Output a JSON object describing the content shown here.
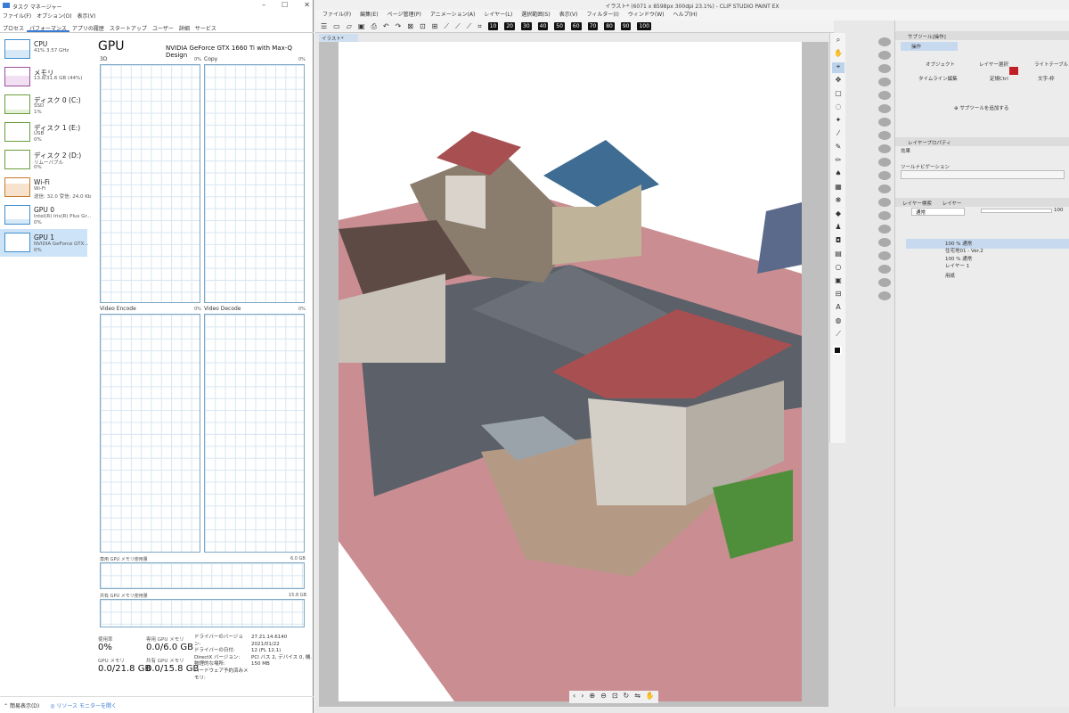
{
  "task_manager": {
    "title": "タスク マネージャー",
    "menu": [
      "ファイル(F)",
      "オプション(O)",
      "表示(V)"
    ],
    "tabs": [
      "プロセス",
      "パフォーマンス",
      "アプリの履歴",
      "スタートアップ",
      "ユーザー",
      "詳細",
      "サービス"
    ],
    "sidebar": [
      {
        "name": "CPU",
        "line1": "41% 3.57 GHz",
        "line2": ""
      },
      {
        "name": "メモリ",
        "line1": "13.8/31.6 GB (44%)",
        "line2": ""
      },
      {
        "name": "ディスク 0 (C:)",
        "line1": "SSD",
        "line2": "1%"
      },
      {
        "name": "ディスク 1 (E:)",
        "line1": "USB",
        "line2": "0%"
      },
      {
        "name": "ディスク 2 (D:)",
        "line1": "リムーバブル",
        "line2": "0%"
      },
      {
        "name": "Wi-Fi",
        "line1": "Wi-Fi",
        "line2": "送信: 32.0 受信: 24.0 Kb"
      },
      {
        "name": "GPU 0",
        "line1": "Intel(R) Iris(R) Plus Gr...",
        "line2": "0%"
      },
      {
        "name": "GPU 1",
        "line1": "NVIDIA GeForce GTX...",
        "line2": "0%"
      }
    ],
    "gpu_title": "GPU",
    "gpu_name": "NVIDIA GeForce GTX 1660 Ti with Max-Q Design",
    "graphs": [
      {
        "label": "3D",
        "pct": "0%"
      },
      {
        "label": "Copy",
        "pct": "0%"
      },
      {
        "label": "Video Encode",
        "pct": "0%"
      },
      {
        "label": "Video Decode",
        "pct": "0%"
      }
    ],
    "dedicated_label": "専用 GPU メモリ使用量",
    "dedicated_max": "6.0 GB",
    "shared_label": "共有 GPU メモリ使用量",
    "shared_max": "15.8 GB",
    "stats": [
      {
        "k": "使用率",
        "v": "0%"
      },
      {
        "k": "専用 GPU メモリ",
        "v": "0.0/6.0 GB"
      },
      {
        "k": "GPU メモリ",
        "v": "0.0/21.8 GB"
      },
      {
        "k": "共有 GPU メモリ",
        "v": "0.0/15.8 GB"
      }
    ],
    "details": [
      {
        "k": "ドライバーのバージョン:",
        "v": "27.21.14.6140"
      },
      {
        "k": "ドライバーの日付:",
        "v": "2021/01/22"
      },
      {
        "k": "DirectX バージョン:",
        "v": "12 (FL 12.1)"
      },
      {
        "k": "物理的な場所:",
        "v": "PCI バス 2, デバイス 0, 機..."
      },
      {
        "k": "ハードウェア予約済みメモリ:",
        "v": "150 MB"
      }
    ],
    "footer_left": "簡易表示(D)",
    "footer_right": "リソース モニターを開く"
  },
  "csp": {
    "title": "イラスト* (6071 x 8598px 300dpi 23.1%)  - CLIP STUDIO PAINT EX",
    "menu": [
      "ファイル(F)",
      "編集(E)",
      "ページ管理(P)",
      "アニメーション(A)",
      "レイヤー(L)",
      "選択範囲(S)",
      "表示(V)",
      "フィルター(I)",
      "ウィンドウ(W)",
      "ヘルプ(H)"
    ],
    "zoom_buttons": [
      "10",
      "20",
      "30",
      "40",
      "50",
      "60",
      "70",
      "80",
      "90",
      "100"
    ],
    "canvas_tab": "イラスト*",
    "subtool_header": "サブツール[操作]",
    "subtool_items": [
      "操作",
      "オブジェクト",
      "レイヤー選択",
      "ライトテーブル",
      "タイムライン編集",
      "定規Ctrl",
      "文字-枠"
    ],
    "add_subtool": "サブツールを追加する",
    "prop_header": "レイヤープロパティ",
    "effect_label": "効果",
    "nav_label": "ツールナビゲーション",
    "layer_tabs": [
      "レイヤー検索",
      "レイヤー"
    ],
    "blend": "通常",
    "opacity": "100",
    "layers": [
      {
        "l1": "100 % 通常",
        "l2": "住宅地01 - Ver.2"
      },
      {
        "l1": "100 % 通常",
        "l2": "レイヤー 1"
      },
      {
        "l1": "用紙",
        "l2": ""
      }
    ]
  }
}
